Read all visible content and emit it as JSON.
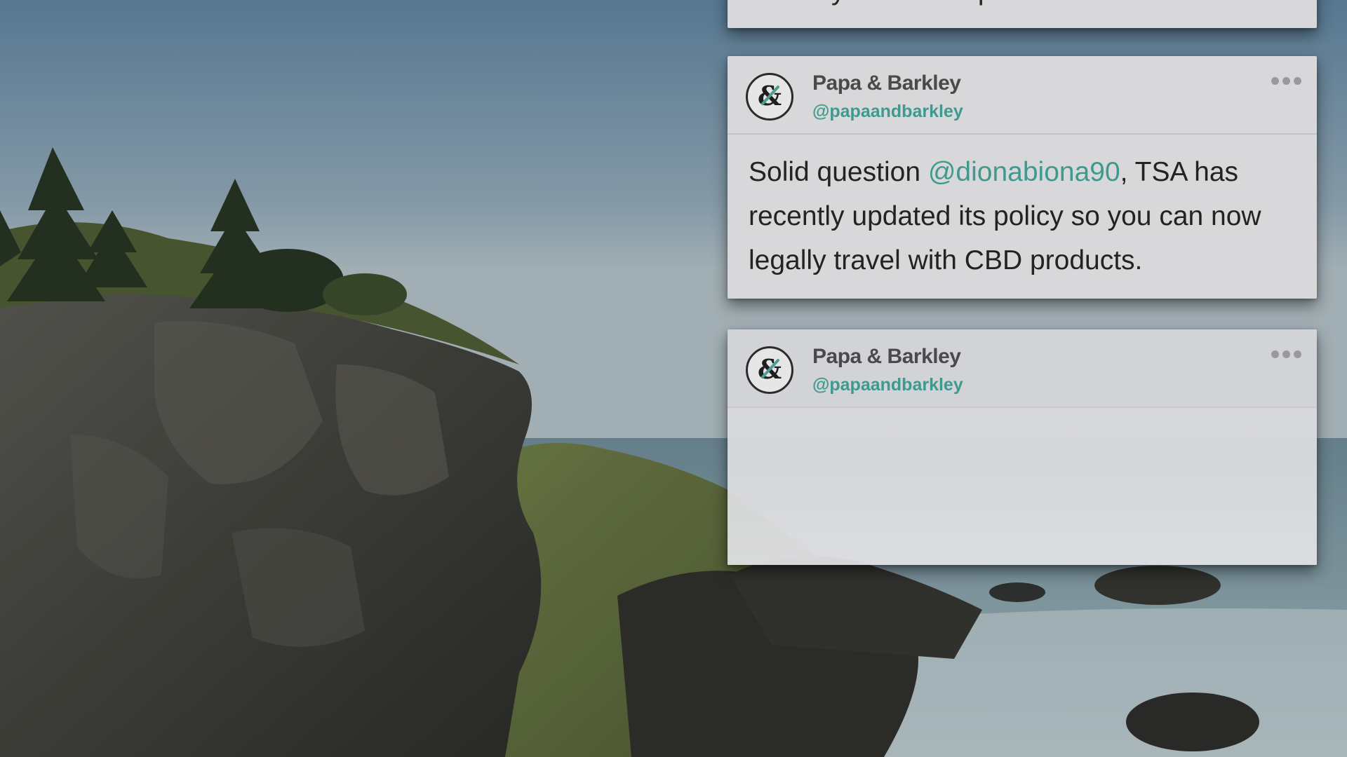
{
  "background": {
    "description_icon": "coastal-cliff-photo",
    "sky_color": "#6f8ea5",
    "sea_color": "#7f98a3",
    "rock_color": "#3d3c38",
    "grass_color": "#5d6a3a"
  },
  "tweets": [
    {
      "partial_text": "can I fly with CBD products?"
    },
    {
      "author_name": "Papa & Barkley",
      "author_handle": "@papaandbarkley",
      "text_before": "Solid question ",
      "mention": "@dionabiona90",
      "text_after": ", TSA has recently updated its policy so you can now legally travel with CBD products.",
      "more_icon": "more-dots-icon"
    },
    {
      "author_name": "Papa & Barkley",
      "author_handle": "@papaandbarkley",
      "more_icon": "more-dots-icon"
    }
  ],
  "colors": {
    "mention": "#3e9a8e",
    "card": "#d8d8da"
  }
}
